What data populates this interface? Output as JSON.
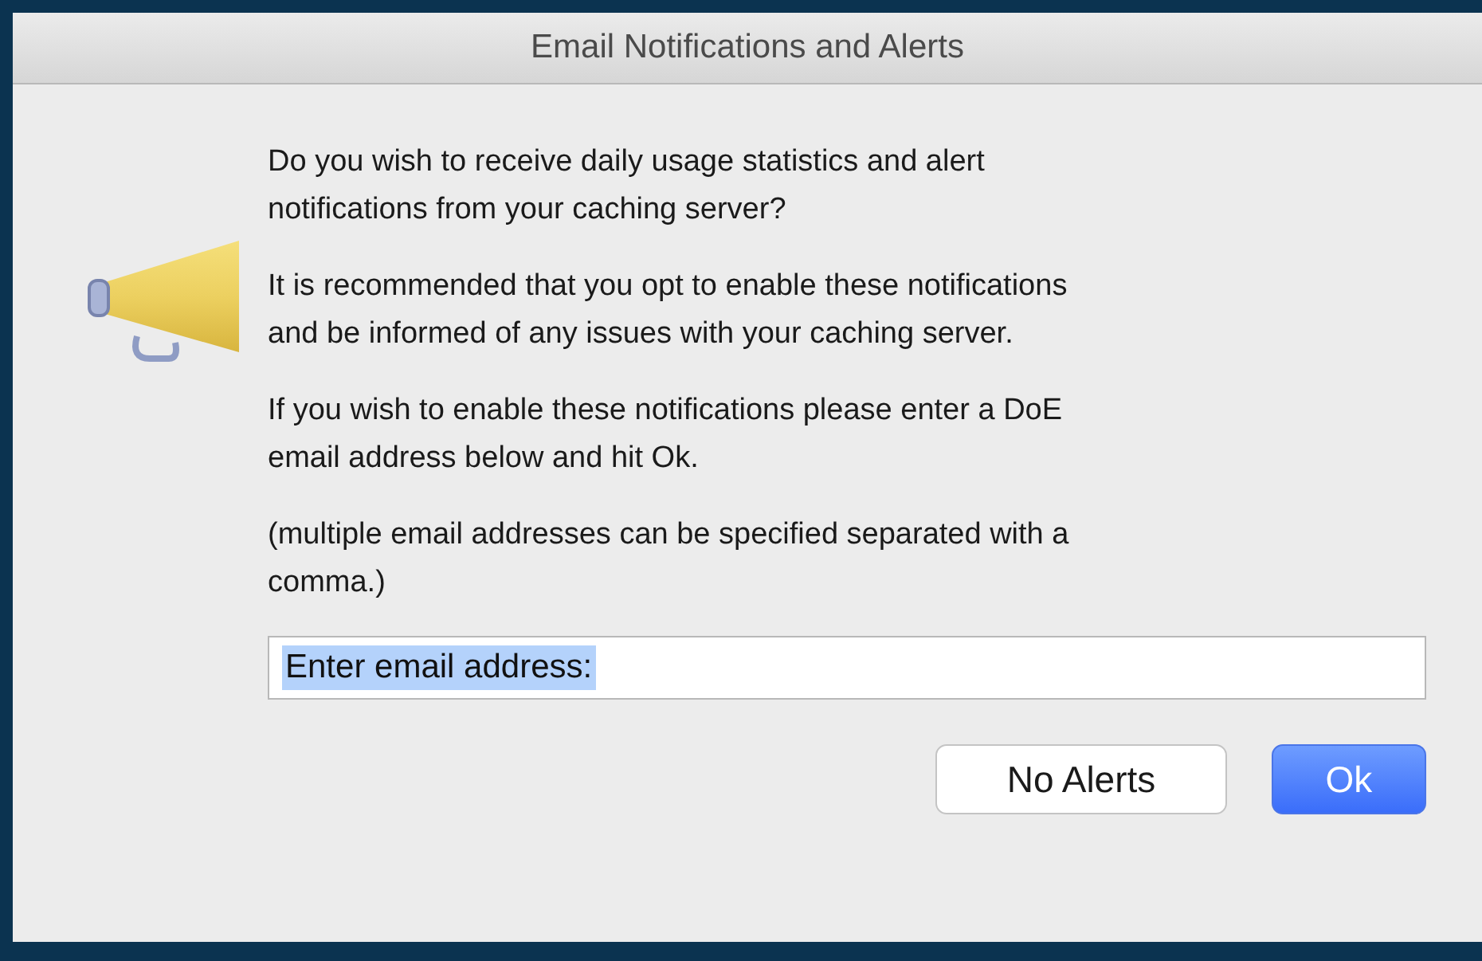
{
  "window": {
    "title": "Email Notifications and Alerts"
  },
  "message": [
    {
      "lines": [
        "Do you wish to receive daily usage statistics and alert",
        "notifications from your caching server?"
      ]
    },
    {
      "lines": [
        "It is recommended that you opt to enable these notifications",
        "and be informed of any issues with your caching server."
      ]
    },
    {
      "lines": [
        "If you wish to enable these notifications please enter a DoE",
        "email address below and hit Ok."
      ]
    },
    {
      "lines": [
        "(multiple email addresses can be specified separated with a",
        "comma.)"
      ]
    }
  ],
  "email_field": {
    "value": "Enter email address:",
    "text_selected": true
  },
  "buttons": [
    {
      "label": "No Alerts",
      "kind": "normal"
    },
    {
      "label": "Ok",
      "kind": "default"
    }
  ]
}
